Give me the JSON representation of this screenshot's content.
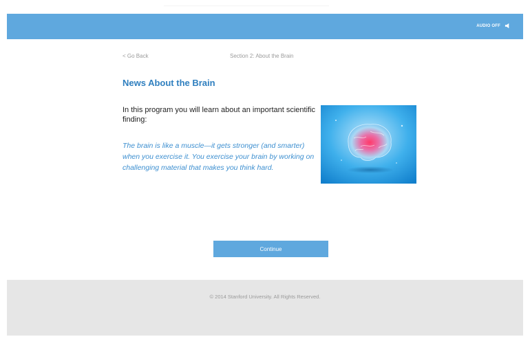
{
  "header": {
    "audio_label": "AUDIO OFF",
    "audio_icon": "speaker-icon",
    "color": "#5fa8de"
  },
  "nav": {
    "back_label": "< Go Back",
    "section_label": "Section 2: About the Brain"
  },
  "main": {
    "title": "News About the Brain",
    "intro": "In this program you will learn about an important scientific finding:",
    "quote": "The brain is like a muscle—it gets stronger (and smarter) when you exercise it. You exercise your brain by working on challenging material that makes you think hard.",
    "image": "brain-image",
    "continue_label": "Continue"
  },
  "footer": {
    "copyright": "© 2014 Stanford University. All Rights Reserved."
  },
  "colors": {
    "accent": "#5fa8de",
    "title": "#2f7fbf",
    "quote": "#3d8fd0",
    "footer_bg": "#e6e6e6"
  }
}
